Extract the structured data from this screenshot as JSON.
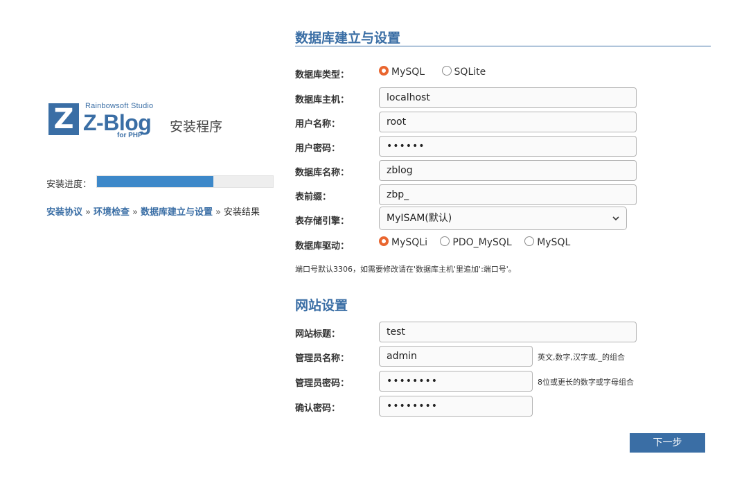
{
  "logo": {
    "mark": "Z",
    "studio": "Rainbowsoft Studio",
    "name": "Z-Blog",
    "sub": "for PHP",
    "installer": "安装程序"
  },
  "progress": {
    "label": "安装进度：",
    "fraction": 0.66
  },
  "steps": [
    {
      "label": "安装协议",
      "done": true
    },
    {
      "label": "环境检查",
      "done": true
    },
    {
      "label": "数据库建立与设置",
      "done": true
    },
    {
      "label": "安装结果",
      "done": false
    }
  ],
  "steps_separator": "»",
  "db": {
    "title": "数据库建立与设置",
    "type_label": "数据库类型：",
    "type_options": [
      "MySQL",
      "SQLite"
    ],
    "type_selected": "MySQL",
    "host_label": "数据库主机：",
    "host_value": "localhost",
    "user_label": "用户名称：",
    "user_value": "root",
    "password_label": "用户密码：",
    "password_value": "••••••",
    "name_label": "数据库名称：",
    "name_value": "zblog",
    "prefix_label": "表前缀：",
    "prefix_value": "zbp_",
    "engine_label": "表存储引擎：",
    "engine_value": "MyISAM(默认)",
    "driver_label": "数据库驱动：",
    "driver_options": [
      "MySQLi",
      "PDO_MySQL",
      "MySQL"
    ],
    "driver_selected": "MySQLi",
    "port_note": "端口号默认3306，如需要修改请在'数据库主机'里追加':端口号'。"
  },
  "site": {
    "title": "网站设置",
    "site_title_label": "网站标题：",
    "site_title_value": "test",
    "admin_name_label": "管理员名称：",
    "admin_name_value": "admin",
    "admin_name_hint": "英文,数字,汉字或._的组合",
    "admin_pw_label": "管理员密码：",
    "admin_pw_value": "••••••••",
    "admin_pw_hint": "8位或更长的数字或字母组合",
    "confirm_label": "确认密码：",
    "confirm_value": "••••••••"
  },
  "next_button": "下一步",
  "colors": {
    "accent": "#3a6ea5",
    "progress": "#3d88c9",
    "radio_selected": "#e9662f"
  }
}
